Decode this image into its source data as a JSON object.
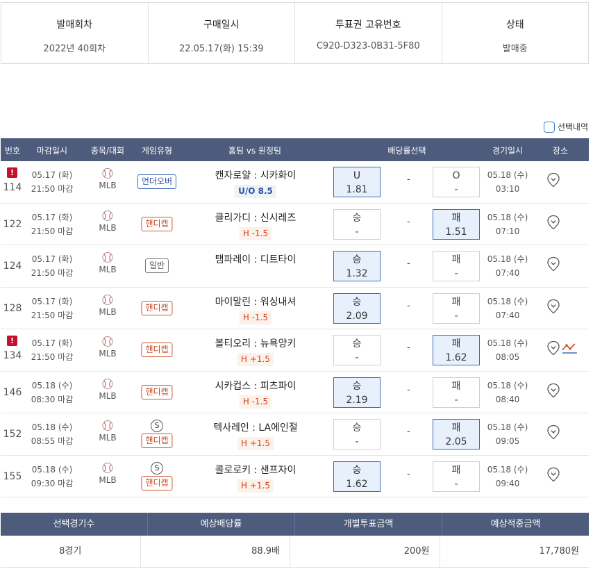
{
  "info": [
    {
      "label": "발매회차",
      "value": "2022년 40회차"
    },
    {
      "label": "구매일시",
      "value": "22.05.17(화) 15:39"
    },
    {
      "label": "투표권 고유번호",
      "value": "C920-D323-0B31-5F80"
    },
    {
      "label": "상태",
      "value": "발매중"
    }
  ],
  "select_toggle_label": "선택내역",
  "headers": {
    "no": "번호",
    "deadline": "마감일시",
    "sport": "종목/대회",
    "type": "게임유형",
    "teams": "홈팀 vs 원정팀",
    "odds": "배당률선택",
    "gdate": "경기일시",
    "place": "장소"
  },
  "games": [
    {
      "alert": "!",
      "no": "114",
      "dl_date": "05.17 (화)",
      "dl_time": "21:50 마감",
      "league": "MLB",
      "type": "언더오버",
      "teams": "캔자로얄 : 시카화이",
      "handicap": "U/O 8.5",
      "left_label": "U",
      "left_odd": "1.81",
      "mid": "-",
      "right_label": "O",
      "right_odd": "-",
      "g_date": "05.18 (수)",
      "g_time": "03:10"
    },
    {
      "no": "122",
      "dl_date": "05.17 (화)",
      "dl_time": "21:50 마감",
      "league": "MLB",
      "type": "핸디캡",
      "teams": "클리가디 : 신시레즈",
      "handicap": "H -1.5",
      "left_label": "승",
      "left_odd": "-",
      "mid": "-",
      "right_label": "패",
      "right_odd": "1.51",
      "g_date": "05.18 (수)",
      "g_time": "07:10"
    },
    {
      "no": "124",
      "dl_date": "05.17 (화)",
      "dl_time": "21:50 마감",
      "league": "MLB",
      "type": "일반",
      "teams": "탬파레이 : 디트타이",
      "left_label": "승",
      "left_odd": "1.32",
      "mid": "-",
      "right_label": "패",
      "right_odd": "-",
      "g_date": "05.18 (수)",
      "g_time": "07:40"
    },
    {
      "no": "128",
      "dl_date": "05.17 (화)",
      "dl_time": "21:50 마감",
      "league": "MLB",
      "type": "핸디캡",
      "teams": "마이말린 : 워싱내셔",
      "handicap": "H -1.5",
      "left_label": "승",
      "left_odd": "2.09",
      "mid": "-",
      "right_label": "패",
      "right_odd": "-",
      "g_date": "05.18 (수)",
      "g_time": "07:40"
    },
    {
      "alert": "!",
      "no": "134",
      "dl_date": "05.17 (화)",
      "dl_time": "21:50 마감",
      "league": "MLB",
      "type": "핸디캡",
      "teams": "볼티오리 : 뉴욕양키",
      "handicap": "H +1.5",
      "left_label": "승",
      "left_odd": "-",
      "mid": "-",
      "right_label": "패",
      "right_odd": "1.62",
      "g_date": "05.18 (수)",
      "g_time": "08:05"
    },
    {
      "no": "146",
      "dl_date": "05.18 (수)",
      "dl_time": "08:30 마감",
      "league": "MLB",
      "type": "핸디캡",
      "teams": "시카컵스 : 피츠파이",
      "handicap": "H -1.5",
      "left_label": "승",
      "left_odd": "2.19",
      "mid": "-",
      "right_label": "패",
      "right_odd": "-",
      "g_date": "05.18 (수)",
      "g_time": "08:40"
    },
    {
      "no": "152",
      "dl_date": "05.18 (수)",
      "dl_time": "08:55 마감",
      "league": "MLB",
      "type": "핸디캡",
      "special": "S",
      "teams": "텍사레인 : LA에인절",
      "handicap": "H +1.5",
      "left_label": "승",
      "left_odd": "-",
      "mid": "-",
      "right_label": "패",
      "right_odd": "2.05",
      "g_date": "05.18 (수)",
      "g_time": "09:05"
    },
    {
      "no": "155",
      "dl_date": "05.18 (수)",
      "dl_time": "09:30 마감",
      "league": "MLB",
      "type": "핸디캡",
      "special": "S",
      "teams": "콜로로키 : 샌프자이",
      "handicap": "H +1.5",
      "left_label": "승",
      "left_odd": "1.62",
      "mid": "-",
      "right_label": "패",
      "right_odd": "-",
      "g_date": "05.18 (수)",
      "g_time": "09:40"
    }
  ],
  "summary": {
    "headers": [
      "선택경기수",
      "예상배당률",
      "개별투표금액",
      "예상적중금액"
    ],
    "values": [
      "8경기",
      "88.9배",
      "200원",
      "17,780원"
    ]
  }
}
